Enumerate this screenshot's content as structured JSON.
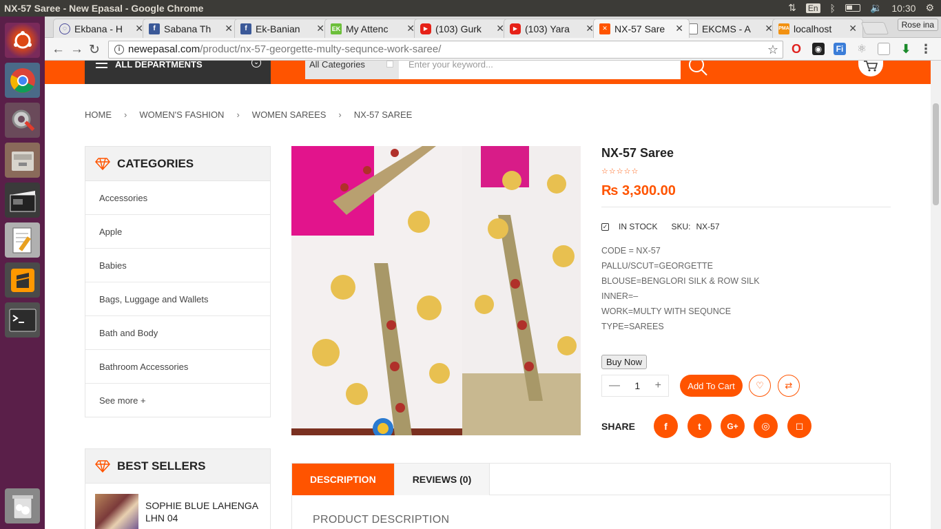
{
  "window": {
    "title": "NX-57 Saree - New Epasal - Google Chrome"
  },
  "system": {
    "keyboard": "En",
    "time": "10:30"
  },
  "launcher": {
    "items": [
      "ubuntu-dash",
      "chrome",
      "system-settings",
      "files",
      "video-editor",
      "text-editor",
      "sublime-text",
      "terminal",
      "trash"
    ]
  },
  "tabs": [
    {
      "title": "Ekbana - H",
      "favicon": "chat",
      "color": "#4a4a9a"
    },
    {
      "title": "Sabana Th",
      "favicon": "facebook",
      "color": "#3b5998"
    },
    {
      "title": "Ek-Banian",
      "favicon": "facebook",
      "color": "#3b5998"
    },
    {
      "title": "My Attenc",
      "favicon": "ek",
      "color": "#6cbf3a"
    },
    {
      "title": "(103) Gurk",
      "favicon": "youtube",
      "color": "#e62117"
    },
    {
      "title": "(103) Yara",
      "favicon": "youtube",
      "color": "#e62117"
    },
    {
      "title": "NX-57 Sare",
      "favicon": "epasal",
      "color": "#ff5400"
    },
    {
      "title": "EKCMS - A",
      "favicon": "document",
      "color": "#777777"
    },
    {
      "title": "localhost",
      "favicon": "pma",
      "color": "#f29111"
    }
  ],
  "profile": "Rose ina",
  "address": {
    "domain": "newepasal.com",
    "path": "/product/nx-57-georgette-multy-sequnce-work-saree/"
  },
  "header": {
    "departments": "ALL DEPARTMENTS",
    "search_category": "All Categories",
    "search_placeholder": "Enter your keyword..."
  },
  "breadcrumb": [
    "HOME",
    "WOMEN'S FASHION",
    "WOMEN SAREES",
    "NX-57 SAREE"
  ],
  "sidebar": {
    "categories_title": "CATEGORIES",
    "categories": [
      "Accessories",
      "Apple",
      "Babies",
      "Bags, Luggage and Wallets",
      "Bath and Body",
      "Bathroom Accessories",
      "See more +"
    ],
    "best_sellers_title": "BEST SELLERS",
    "best_sellers": [
      {
        "name": "SOPHIE BLUE LAHENGA LHN 04"
      }
    ]
  },
  "product": {
    "title": "NX-57 Saree",
    "rating": 0,
    "price": "₨ 3,300.00",
    "stock": "IN STOCK",
    "sku_label": "SKU:",
    "sku": "NX-57",
    "details": [
      "CODE = NX-57",
      "PALLU/SCUT=GEORGETTE",
      "BLOUSE=BENGLORI SILK & ROW SILK",
      "INNER=–",
      "WORK=MULTY WITH SEQUNCE",
      "TYPE=SAREES"
    ],
    "buy_now": "Buy Now",
    "quantity": "1",
    "add_to_cart": "Add To Cart",
    "share_label": "SHARE",
    "share_icons": [
      "facebook",
      "twitter",
      "google-plus",
      "dribbble",
      "instagram"
    ]
  },
  "info_tabs": [
    {
      "label": "DESCRIPTION",
      "active": true
    },
    {
      "label": "REVIEWS (0)",
      "active": false
    }
  ],
  "description_heading": "PRODUCT DESCRIPTION",
  "colors": {
    "accent": "#ff5400",
    "launcher": "#5a1f49",
    "topbar": "#3c3b37"
  }
}
